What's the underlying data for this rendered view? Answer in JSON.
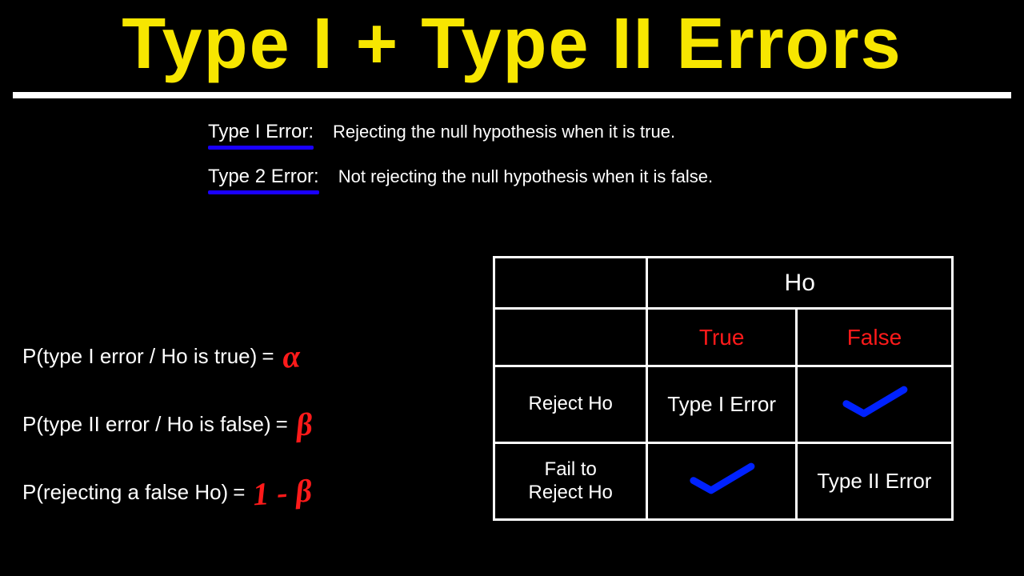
{
  "title": "Type I + Type II Errors",
  "defs": {
    "t1_label": "Type I Error:",
    "t1_text": "Rejecting the null hypothesis when it is true.",
    "t2_label": "Type 2 Error:",
    "t2_text": "Not rejecting the null hypothesis when it is false."
  },
  "probs": {
    "p1": "P(type I error / Ho is true)",
    "p1_eq": "=",
    "p1_sym": "α",
    "p2": "P(type II error / Ho is false)",
    "p2_eq": "=",
    "p2_sym": "β",
    "p3": "P(rejecting a false Ho)",
    "p3_eq": "=",
    "p3_sym": "1 - β"
  },
  "table": {
    "h0": "Ho",
    "true": "True",
    "false": "False",
    "reject": "Reject Ho",
    "fail": "Fail to Reject Ho",
    "t1": "Type I Error",
    "t2": "Type II Error"
  }
}
